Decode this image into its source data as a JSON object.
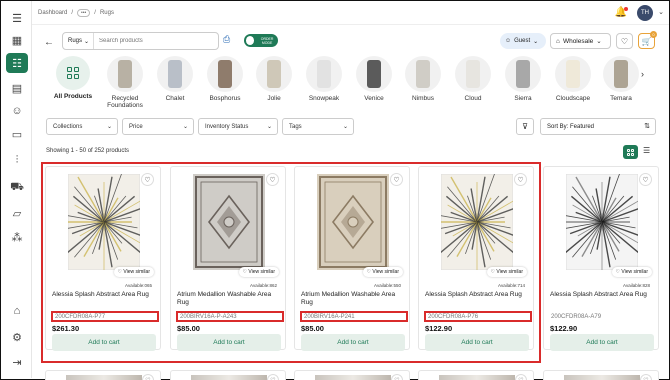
{
  "breadcrumb": {
    "dashboard": "Dashboard",
    "ellipsis": "•••",
    "current": "Rugs"
  },
  "user": {
    "initials": "TH"
  },
  "search": {
    "category": "Rugs",
    "placeholder": "Search products"
  },
  "toggle": {
    "label": "ORDER MODE"
  },
  "header": {
    "guest_label": "Guest",
    "pricing_label": "Wholesale",
    "cart_count": "0"
  },
  "categories": [
    {
      "label": "All Products",
      "color": "#e7f1ec"
    },
    {
      "label": "Recycled Foundations",
      "color": "#b8b1a4"
    },
    {
      "label": "Chalet",
      "color": "#b9bfc8"
    },
    {
      "label": "Bosphorus",
      "color": "#8f7c6c"
    },
    {
      "label": "Jolie",
      "color": "#cfc8b8"
    },
    {
      "label": "Snowpeak",
      "color": "#e2e2e2"
    },
    {
      "label": "Venice",
      "color": "#5b5b5b"
    },
    {
      "label": "Nimbus",
      "color": "#d0cdc6"
    },
    {
      "label": "Cloud",
      "color": "#e7e5e0"
    },
    {
      "label": "Sierra",
      "color": "#a8a8a8"
    },
    {
      "label": "Cloudscape",
      "color": "#efe9d9"
    },
    {
      "label": "Temara",
      "color": "#ada494"
    }
  ],
  "filters": {
    "collections": "Collections",
    "price": "Price",
    "inventory": "Inventory Status",
    "tags": "Tags",
    "sort": "Sort By: Featured"
  },
  "results": {
    "showing": "Showing 1 - 50 of 252 products"
  },
  "products": [
    {
      "title": "Alessia Splash Abstract Area Rug",
      "sku": "200CFDR08A-P77",
      "price": "$261.30",
      "available": "Available:065",
      "view_similar": "View similar",
      "add_to_cart": "Add to cart",
      "pattern": "splash"
    },
    {
      "title": "Atrium Medallion Washable Area Rug",
      "sku": "200BIRV16A-P-A243",
      "price": "$85.00",
      "available": "Available:862",
      "view_similar": "View similar",
      "add_to_cart": "Add to cart",
      "pattern": "medallion-grey"
    },
    {
      "title": "Atrium Medallion Washable Area Rug",
      "sku": "200BIRV16A-P241",
      "price": "$85.00",
      "available": "Available:550",
      "view_similar": "View similar",
      "add_to_cart": "Add to cart",
      "pattern": "medallion-beige"
    },
    {
      "title": "Alessia Splash Abstract Area Rug",
      "sku": "200CFDR08A-P76",
      "price": "$122.90",
      "available": "Available:714",
      "view_similar": "View similar",
      "add_to_cart": "Add to cart",
      "pattern": "splash"
    },
    {
      "title": "Alessia Splash Abstract Area Rug",
      "sku": "200CFDR08A-A79",
      "price": "$122.90",
      "available": "Available:828",
      "view_similar": "View similar",
      "add_to_cart": "Add to cart",
      "pattern": "splash-dark"
    }
  ]
}
